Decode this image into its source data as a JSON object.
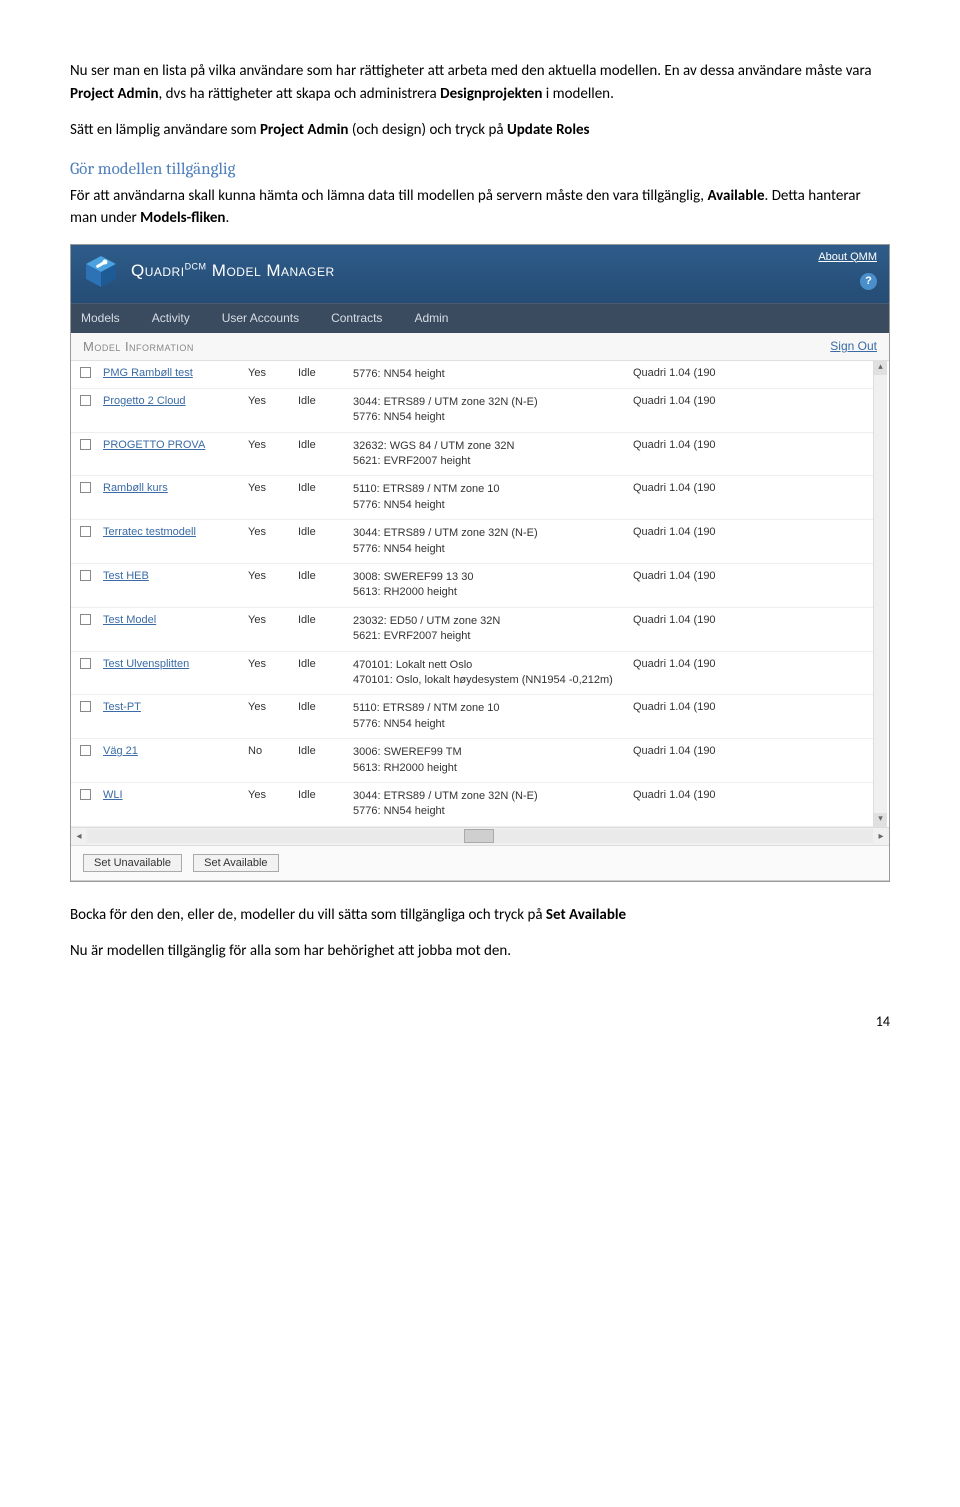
{
  "para1_pre": "Nu ser man en lista på vilka användare som har rättigheter att arbeta med den aktuella modellen. En av dessa användare måste vara ",
  "para1_b1": "Project Admin",
  "para1_mid": ", dvs ha rättigheter att skapa och administrera ",
  "para1_b2": "Designprojekten",
  "para1_end": " i modellen.",
  "para2_pre": "Sätt en lämplig användare som ",
  "para2_b1": "Project Admin",
  "para2_mid": " (och design) och tryck på ",
  "para2_b2": "Update Roles",
  "h3": "Gör modellen tillgänglig",
  "para3_pre": "För att användarna skall kunna hämta och lämna data till modellen på servern måste den vara tillgänglig, ",
  "para3_b1": "Available",
  "para3_mid": ". Detta hanterar man under ",
  "para3_b2": "Models-fliken",
  "para3_end": ".",
  "app": {
    "title_a": "Quadri",
    "title_sup": "DCM",
    "title_b": " Model Manager",
    "about": "About QMM",
    "help": "?",
    "nav": [
      "Models",
      "Activity",
      "User Accounts",
      "Contracts",
      "Admin"
    ],
    "sub_l": "Model Information",
    "sub_r": "Sign Out",
    "rows": [
      {
        "name": "PMG Rambøll test",
        "avail": "Yes",
        "act": "Idle",
        "crs": "5776: NN54 height",
        "fc": "Quadri 1.04 (190"
      },
      {
        "name": "Progetto 2 Cloud",
        "avail": "Yes",
        "act": "Idle",
        "crs": "3044: ETRS89 / UTM zone 32N (N-E)\n5776: NN54 height",
        "fc": "Quadri 1.04 (190"
      },
      {
        "name": "PROGETTO PROVA",
        "avail": "Yes",
        "act": "Idle",
        "crs": "32632: WGS 84 / UTM zone 32N\n5621: EVRF2007 height",
        "fc": "Quadri 1.04 (190"
      },
      {
        "name": "Rambøll kurs",
        "avail": "Yes",
        "act": "Idle",
        "crs": "5110: ETRS89 / NTM zone 10\n5776: NN54 height",
        "fc": "Quadri 1.04 (190"
      },
      {
        "name": "Terratec testmodell",
        "avail": "Yes",
        "act": "Idle",
        "crs": "3044: ETRS89 / UTM zone 32N (N-E)\n5776: NN54 height",
        "fc": "Quadri 1.04 (190"
      },
      {
        "name": "Test HEB",
        "avail": "Yes",
        "act": "Idle",
        "crs": "3008: SWEREF99 13 30\n5613: RH2000 height",
        "fc": "Quadri 1.04 (190"
      },
      {
        "name": "Test Model",
        "avail": "Yes",
        "act": "Idle",
        "crs": "23032: ED50 / UTM zone 32N\n5621: EVRF2007 height",
        "fc": "Quadri 1.04 (190"
      },
      {
        "name": "Test Ulvensplitten",
        "avail": "Yes",
        "act": "Idle",
        "crs": "470101: Lokalt nett Oslo\n470101: Oslo, lokalt høydesystem (NN1954 -0,212m)",
        "fc": "Quadri 1.04 (190"
      },
      {
        "name": "Test-PT",
        "avail": "Yes",
        "act": "Idle",
        "crs": "5110: ETRS89 / NTM zone 10\n5776: NN54 height",
        "fc": "Quadri 1.04 (190"
      },
      {
        "name": "Väg 21",
        "avail": "No",
        "act": "Idle",
        "crs": "3006: SWEREF99 TM\n5613: RH2000 height",
        "fc": "Quadri 1.04 (190"
      },
      {
        "name": "WLI",
        "avail": "Yes",
        "act": "Idle",
        "crs": "3044: ETRS89 / UTM zone 32N (N-E)\n5776: NN54 height",
        "fc": "Quadri 1.04 (190"
      }
    ],
    "btn_unavail": "Set Unavailable",
    "btn_avail": "Set Available"
  },
  "para4_pre": "Bocka för den den, eller de, modeller du vill sätta som tillgängliga och tryck på ",
  "para4_b1": "Set Available",
  "para5_pre": "Nu är modellen tillgänglig för alla som har behörighet att jobba mot den.",
  "pg": "14"
}
